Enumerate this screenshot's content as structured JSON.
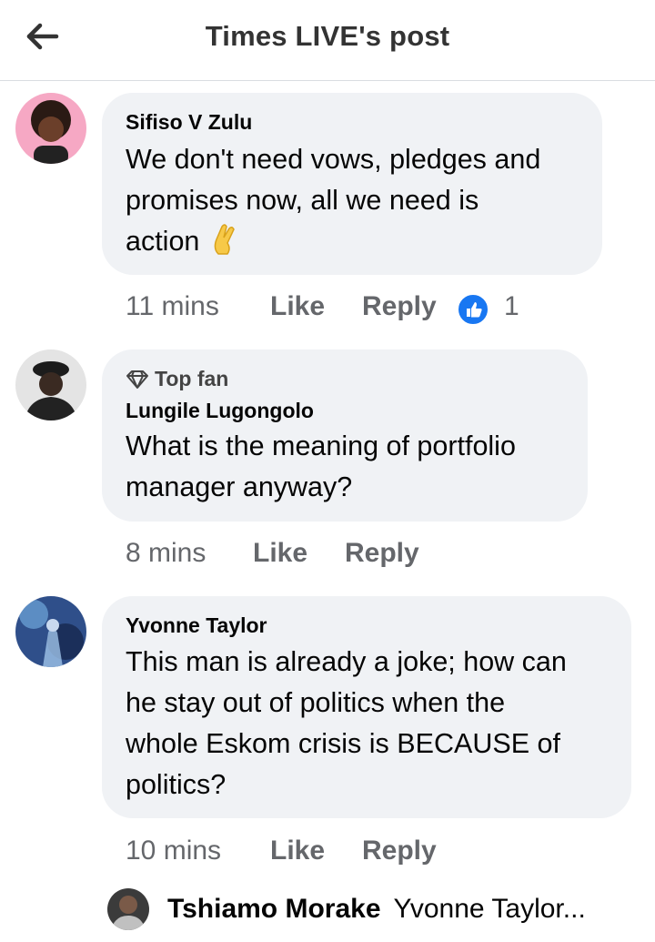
{
  "header": {
    "title": "Times LIVE's post",
    "back_icon": "arrow-left-icon"
  },
  "comments": [
    {
      "author": "Sifiso V Zulu",
      "lines": [
        "We don't need vows, pledges and",
        "promises now, all we need is",
        "action"
      ],
      "emoji_icon": "crossed-fingers-icon",
      "time": "11 mins",
      "like_label": "Like",
      "reply_label": "Reply",
      "reaction_icon": "thumbs-up-icon",
      "reaction_count": "1"
    },
    {
      "badge": "Top fan",
      "badge_icon": "diamond-icon",
      "author": "Lungile Lugongolo",
      "lines": [
        "What is the meaning of portfolio",
        "manager anyway?"
      ],
      "time": "8 mins",
      "like_label": "Like",
      "reply_label": "Reply"
    },
    {
      "author": "Yvonne Taylor",
      "lines": [
        "This man is already a joke; how can",
        "he stay out of politics when the",
        "whole Eskom crisis is BECAUSE of",
        "politics?"
      ],
      "time": "10 mins",
      "like_label": "Like",
      "reply_label": "Reply"
    }
  ],
  "reply_preview": {
    "name": "Tshiamo Morake",
    "text": "Yvonne Taylor..."
  },
  "colors": {
    "bubble": "#f0f2f5",
    "meta_text": "#65676b",
    "like_blue": "#1877f2"
  }
}
